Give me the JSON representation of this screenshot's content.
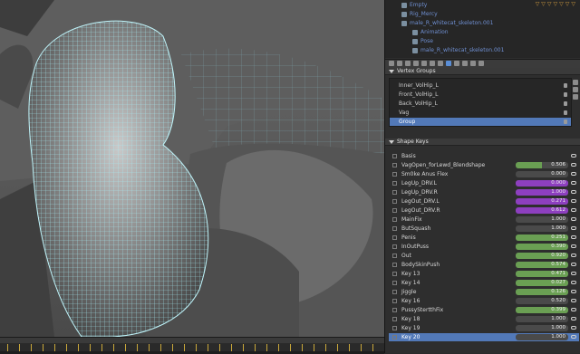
{
  "outliner": {
    "items": [
      {
        "label": "Empty",
        "indent": 1
      },
      {
        "label": "Rig_Mercy",
        "indent": 1
      },
      {
        "label": "male_R_whitecat_skeleton.001",
        "indent": 1
      },
      {
        "label": "Animation",
        "indent": 2
      },
      {
        "label": "Pose",
        "indent": 2
      },
      {
        "label": "male_R_whitecat_skeleton.001",
        "indent": 2
      }
    ]
  },
  "vertex_groups": {
    "title": "Vertex Groups",
    "items": [
      {
        "label": "Inner_VolHip_L",
        "selected": false
      },
      {
        "label": "Front_VolHip_L",
        "selected": false
      },
      {
        "label": "Back_VolHip_L",
        "selected": false
      },
      {
        "label": "Vag",
        "selected": false
      },
      {
        "label": "Group",
        "selected": true
      }
    ]
  },
  "shape_keys": {
    "title": "Shape Keys",
    "colors": {
      "green": "#6a9f53",
      "purple": "#8d3fbf",
      "empty": "#4a4a4a"
    },
    "items": [
      {
        "label": "Basis",
        "value": "",
        "fill": 0,
        "color": "none"
      },
      {
        "label": "VagOpen_forLewd_Blendshape",
        "value": "0.506",
        "fill": 0.506,
        "color": "green"
      },
      {
        "label": "Sm0ke Anus Flex",
        "value": "0.000",
        "fill": 0,
        "color": "empty"
      },
      {
        "label": "LegUp_DRV.L",
        "value": "0.000",
        "fill": 1,
        "color": "purple"
      },
      {
        "label": "LegUp_DRV.R",
        "value": "1.000",
        "fill": 1,
        "color": "purple"
      },
      {
        "label": "LegOut_DRV.L",
        "value": "0.271",
        "fill": 1,
        "color": "purple"
      },
      {
        "label": "LegOut_DRV.R",
        "value": "0.612",
        "fill": 1,
        "color": "purple"
      },
      {
        "label": "MainFix",
        "value": "1.000",
        "fill": 0,
        "color": "empty"
      },
      {
        "label": "ButSquash",
        "value": "1.000",
        "fill": 0,
        "color": "empty"
      },
      {
        "label": "Penis",
        "value": "0.251",
        "fill": 1,
        "color": "green"
      },
      {
        "label": "InOutPuss",
        "value": "0.390",
        "fill": 1,
        "color": "green"
      },
      {
        "label": "Out",
        "value": "0.920",
        "fill": 1,
        "color": "green"
      },
      {
        "label": "BodySkinPush",
        "value": "0.574",
        "fill": 1,
        "color": "green"
      },
      {
        "label": "Key 13",
        "value": "0.471",
        "fill": 1,
        "color": "green"
      },
      {
        "label": "Key 14",
        "value": "0.027",
        "fill": 1,
        "color": "green"
      },
      {
        "label": "Jiggle",
        "value": "0.126",
        "fill": 1,
        "color": "green"
      },
      {
        "label": "Key 16",
        "value": "0.520",
        "fill": 0,
        "color": "empty"
      },
      {
        "label": "PussyStertthFix",
        "value": "0.399",
        "fill": 1,
        "color": "green"
      },
      {
        "label": "Key 18",
        "value": "1.000",
        "fill": 0,
        "color": "empty"
      },
      {
        "label": "Key 19",
        "value": "1.000",
        "fill": 0,
        "color": "empty"
      },
      {
        "label": "Key 20",
        "value": "1.000",
        "fill": 0,
        "color": "empty",
        "selected": true
      }
    ]
  },
  "viewport": {
    "wire_color": "#9fe6ef",
    "mesh_color": "#6a6a6a"
  }
}
